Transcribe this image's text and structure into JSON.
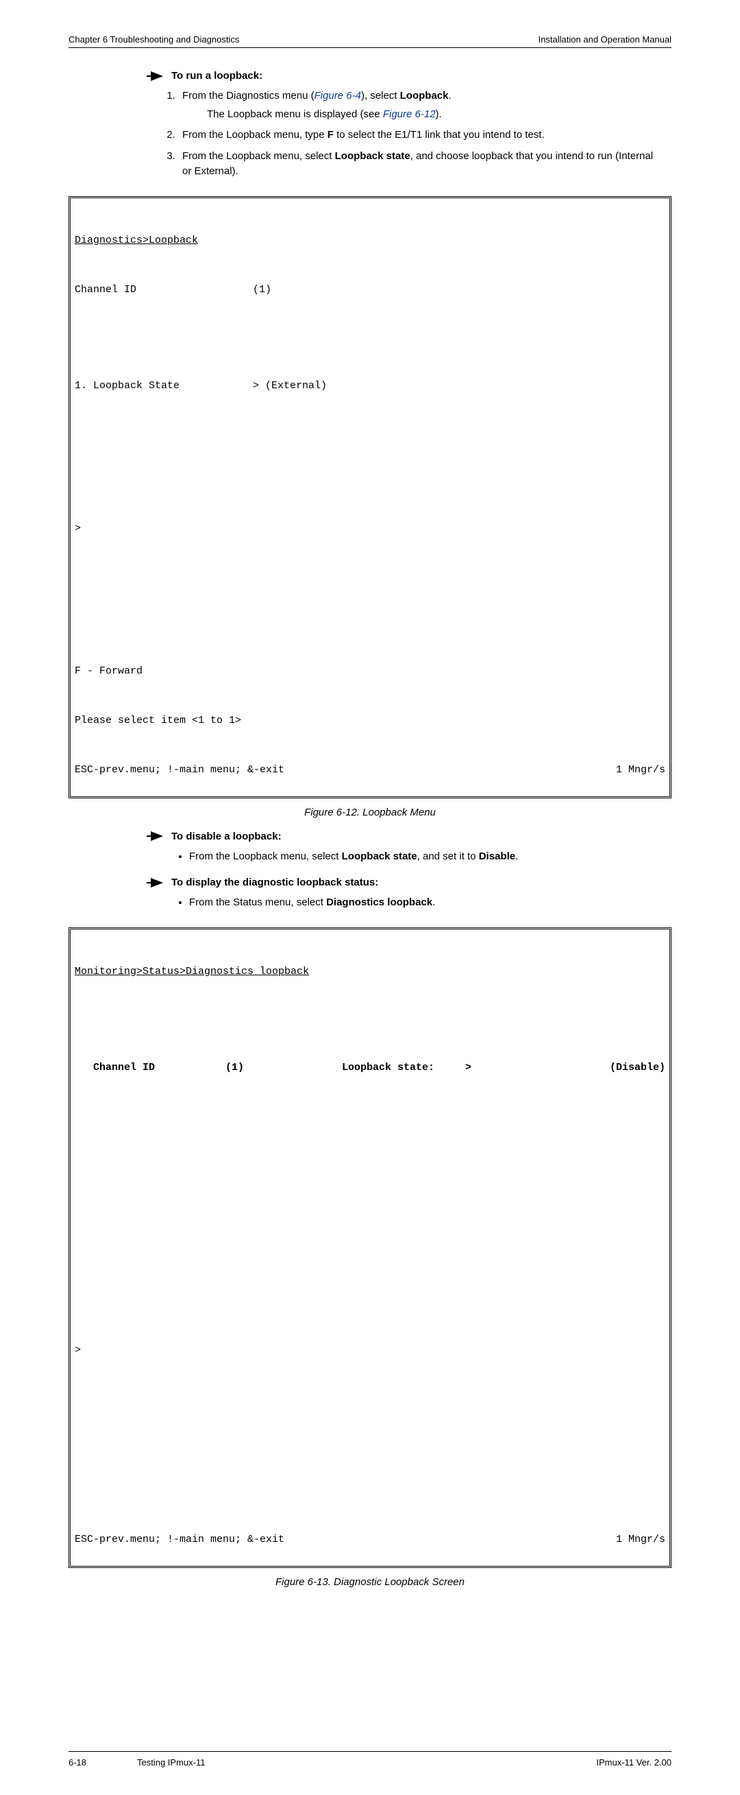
{
  "header": {
    "left": "Chapter 6  Troubleshooting and Diagnostics",
    "right": "Installation and Operation Manual"
  },
  "proc1": {
    "title": "To run a loopback:",
    "step1_pre": "From the Diagnostics menu (",
    "step1_link1": "Figure 6-4",
    "step1_mid": "), select ",
    "step1_bold": "Loopback",
    "step1_end": ".",
    "step1_sub_pre": "The Loopback menu is displayed (see ",
    "step1_sub_link": "Figure 6-12",
    "step1_sub_end": ").",
    "step2_pre": "From the Loopback menu, type ",
    "step2_bold": "F",
    "step2_end": " to select the E1/T1 link that you intend to test.",
    "step3_pre": "From the Loopback menu, select ",
    "step3_bold": "Loopback state",
    "step3_end": ", and choose loopback that you intend to run (Internal or External)."
  },
  "terminal1": {
    "title": "Diagnostics>Loopback",
    "l1a": "Channel ID",
    "l1b": "(1)",
    "l2a": "1. Loopback State",
    "l2b": "> (External)",
    "l3": ">",
    "l4": "F - Forward",
    "l5": "Please select item <1 to 1>",
    "l6a": "ESC-prev.menu; !-main menu; &-exit",
    "l6b": "1 Mngr/s"
  },
  "caption1": "Figure 6-12.  Loopback Menu",
  "proc2": {
    "title": "To disable a loopback:",
    "bullet_pre": "From the Loopback menu, select ",
    "bullet_bold": "Loopback state",
    "bullet_mid": ", and set it to ",
    "bullet_bold2": "Disable",
    "bullet_end": "."
  },
  "proc3": {
    "title": "To display the diagnostic loopback status:",
    "bullet_pre": "From the Status menu, select ",
    "bullet_bold": "Diagnostics loopback",
    "bullet_end": "."
  },
  "terminal2": {
    "title": "Monitoring>Status>Diagnostics loopback",
    "l1a": "   Channel ID",
    "l1b": "(1)",
    "l1c": "Loopback state:",
    "l1d": ">",
    "l1e": "(Disable)",
    "l2": ">",
    "l3a": "ESC-prev.menu; !-main menu; &-exit",
    "l3b": "1 Mngr/s"
  },
  "caption2": "Figure 6-13.  Diagnostic Loopback Screen",
  "footer": {
    "left": "6-18",
    "mid": "Testing IPmux-11",
    "right": "IPmux-11 Ver. 2.00"
  }
}
